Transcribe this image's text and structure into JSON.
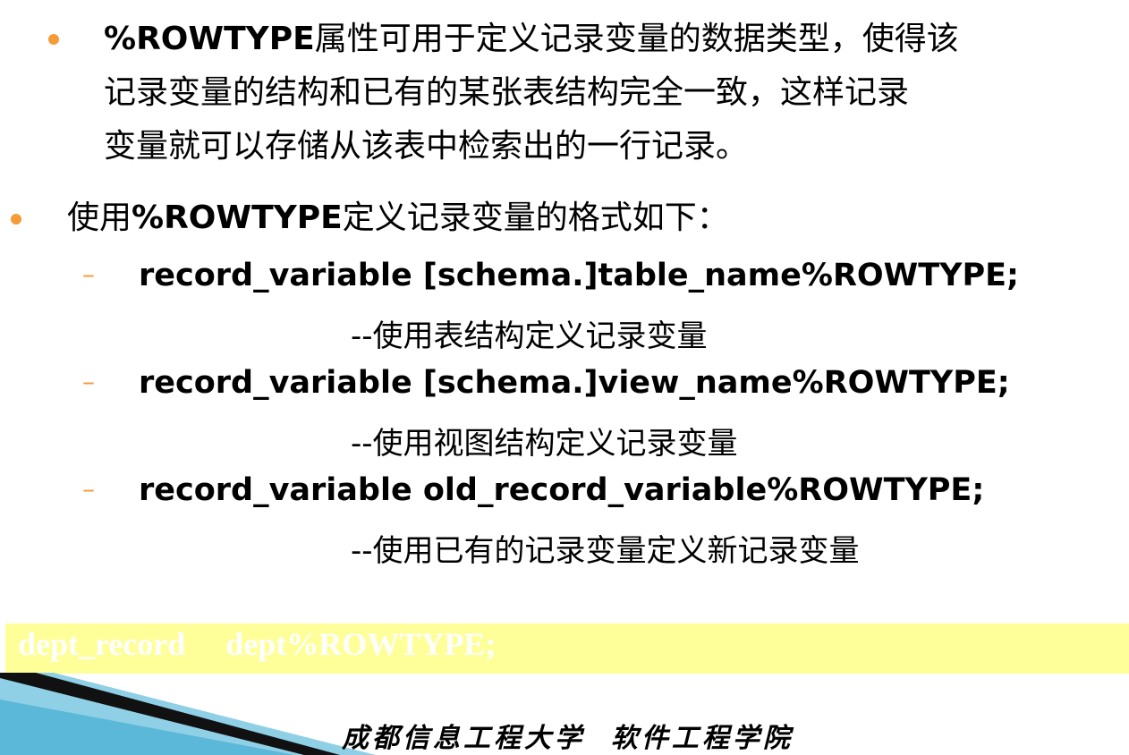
{
  "intro": {
    "keyword": "%ROWTYPE",
    "line1_rest": "属性可用于定义记录变量的数据类型，使得该",
    "line2": "记录变量的结构和已有的某张表结构完全一致，这样记录",
    "line3": "变量就可以存储从该表中检索出的一行记录。"
  },
  "format": {
    "prefix": "使用",
    "keyword": "%ROWTYPE",
    "suffix": "定义记录变量的格式如下："
  },
  "syntax": [
    {
      "code": "record_variable [schema.]table_name%ROWTYPE;",
      "comment": "--使用表结构定义记录变量"
    },
    {
      "code": "record_variable [schema.]view_name%ROWTYPE;",
      "comment": "--使用视图结构定义记录变量"
    },
    {
      "code": "record_variable old_record_variable%ROWTYPE;",
      "comment": "--使用已有的记录变量定义新记录变量"
    }
  ],
  "example": {
    "code": "dept_record     dept%ROWTYPE;"
  },
  "footer": {
    "text": "成都信息工程大学  软件工程学院"
  },
  "colors": {
    "bullet": "#f39c38",
    "highlight_bar": "#ffff99",
    "deco_dark": "#111111",
    "deco_blue": "#5bb8d8"
  }
}
